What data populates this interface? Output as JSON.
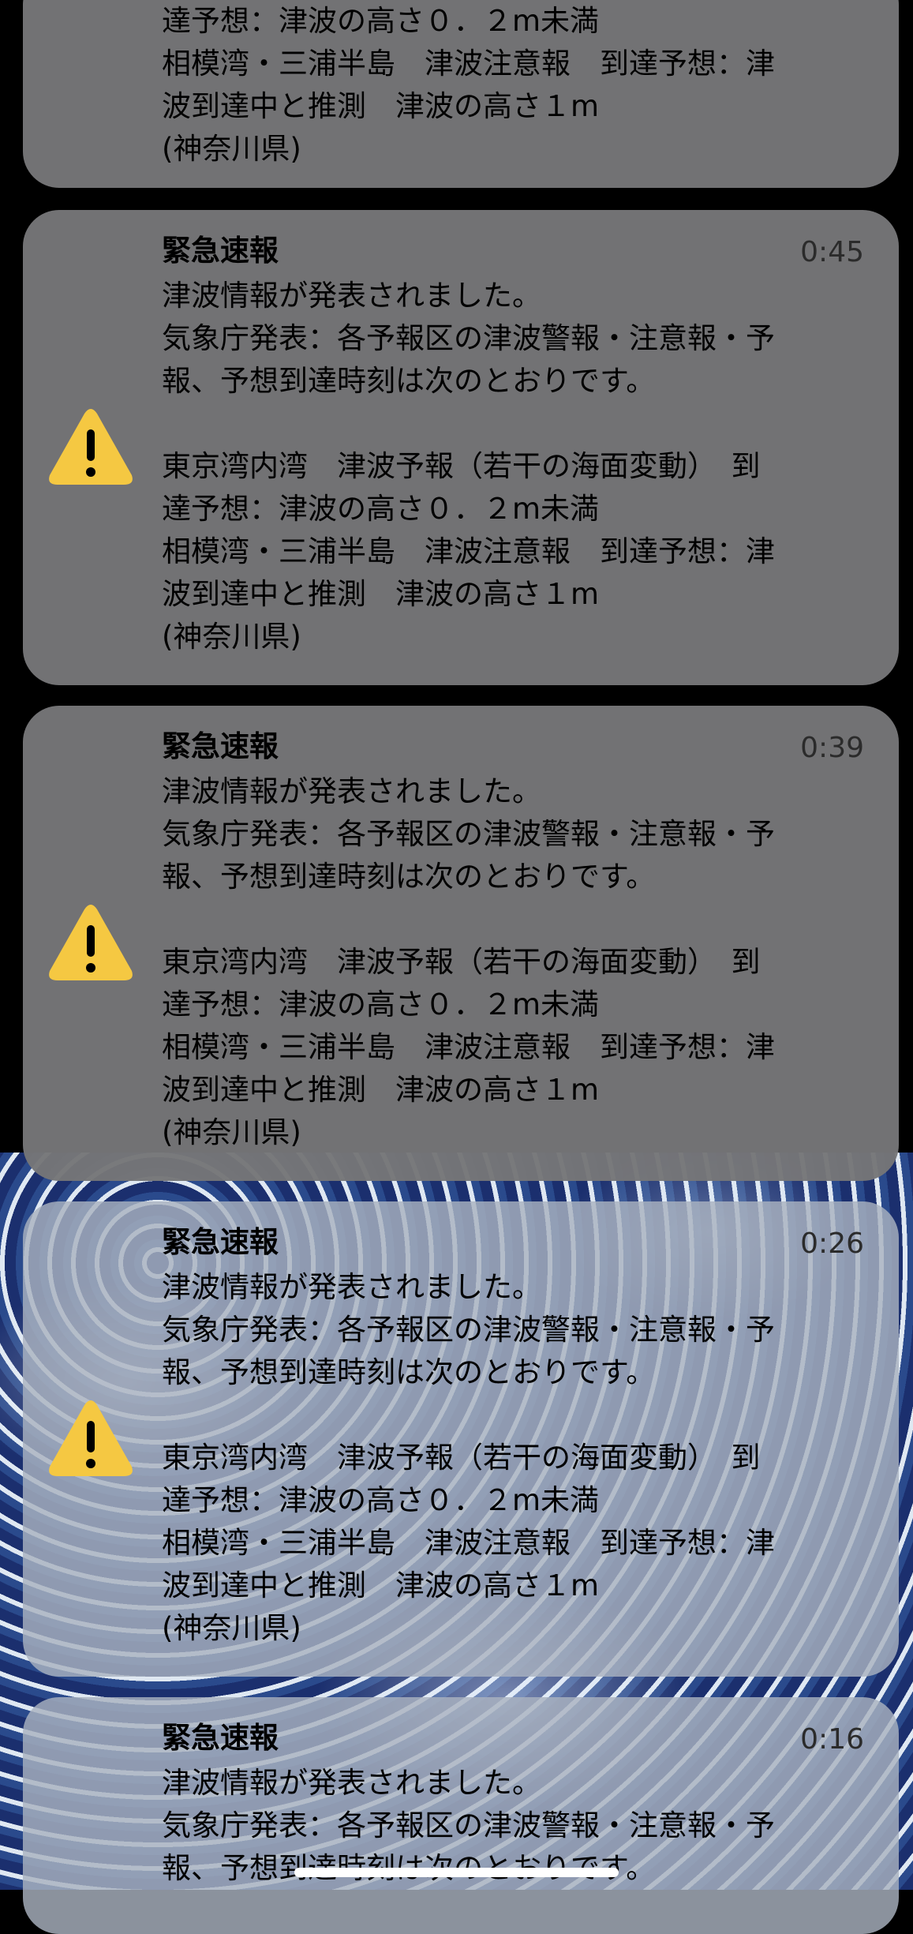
{
  "top_card": {
    "lines": [
      "達予想：津波の高さ０．２m未満",
      "相模湾・三浦半島　津波注意報　到達予想：津",
      "波到達中と推測　津波の高さ１m",
      "(神奈川県)"
    ]
  },
  "notifications": [
    {
      "title": "緊急速報",
      "time": "0:45",
      "lines": [
        "津波情報が発表されました。",
        "気象庁発表：各予報区の津波警報・注意報・予",
        "報、予想到達時刻は次のとおりです。",
        "",
        "東京湾内湾　津波予報（若干の海面変動）　到",
        "達予想：津波の高さ０．２m未満",
        "相模湾・三浦半島　津波注意報　到達予想：津",
        "波到達中と推測　津波の高さ１m",
        "(神奈川県)"
      ]
    },
    {
      "title": "緊急速報",
      "time": "0:39",
      "lines": [
        "津波情報が発表されました。",
        "気象庁発表：各予報区の津波警報・注意報・予",
        "報、予想到達時刻は次のとおりです。",
        "",
        "東京湾内湾　津波予報（若干の海面変動）　到",
        "達予想：津波の高さ０．２m未満",
        "相模湾・三浦半島　津波注意報　到達予想：津",
        "波到達中と推測　津波の高さ１m",
        "(神奈川県)"
      ]
    },
    {
      "title": "緊急速報",
      "time": "0:26",
      "lines": [
        "津波情報が発表されました。",
        "気象庁発表：各予報区の津波警報・注意報・予",
        "報、予想到達時刻は次のとおりです。",
        "",
        "東京湾内湾　津波予報（若干の海面変動）　到",
        "達予想：津波の高さ０．２m未満",
        "相模湾・三浦半島　津波注意報　到達予想：津",
        "波到達中と推測　津波の高さ１m",
        "(神奈川県)"
      ]
    },
    {
      "title": "緊急速報",
      "time": "0:16",
      "lines": [
        "津波情報が発表されました。",
        "気象庁発表：各予報区の津波警報・注意報・予",
        "報、予想到達時刻は次のとおりです。"
      ]
    }
  ],
  "colors": {
    "warning_icon": "#f5c842",
    "card_dark": "#767678",
    "card_light": "#aab2c0"
  },
  "icons": {
    "notification_icon": "warning-triangle-icon"
  }
}
